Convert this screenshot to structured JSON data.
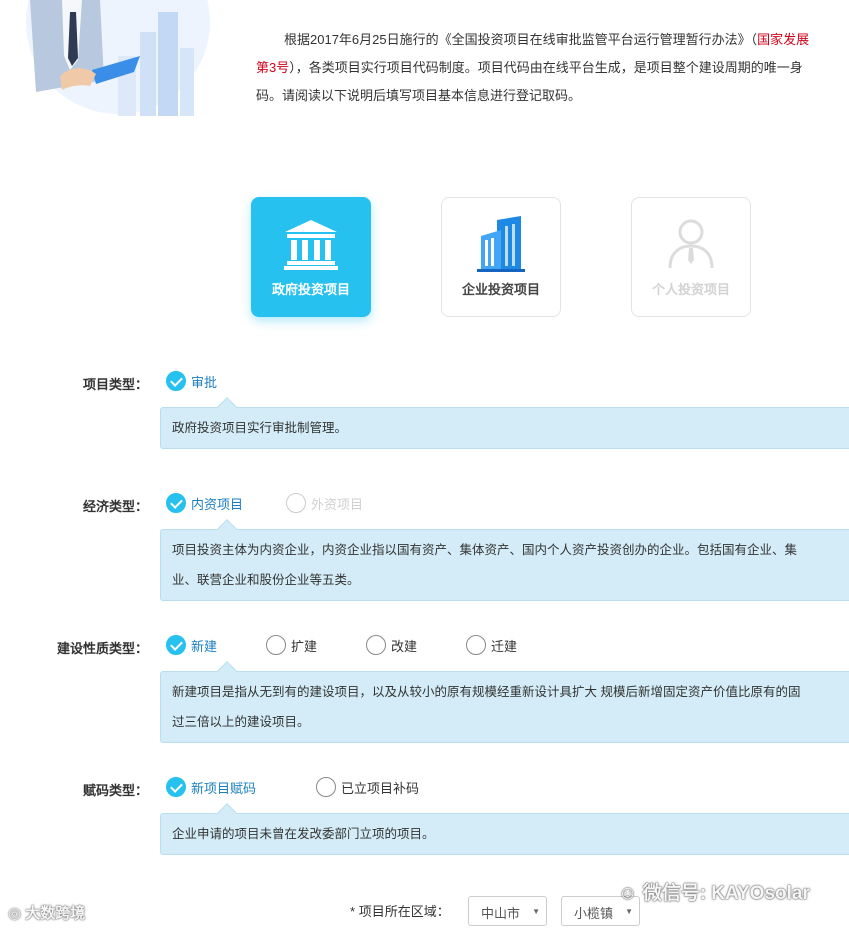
{
  "intro": {
    "line1": "根据2017年6月25日施行的《全国投资项目在线审批监管平台运行管理暂行办法》（",
    "line1_red": "国家发展",
    "line2_red": "第3号",
    "line2": "），各类项目实行项目代码制度。项目代码由在线平台生成，是项目整个建设周期的唯一身",
    "line3": "码。请阅读以下说明后填写项目基本信息进行登记取码。"
  },
  "categories": [
    {
      "label": "政府投资项目",
      "icon": "government-building-icon",
      "state": "active"
    },
    {
      "label": "企业投资项目",
      "icon": "office-building-icon",
      "state": "normal"
    },
    {
      "label": "个人投资项目",
      "icon": "person-icon",
      "state": "disabled"
    }
  ],
  "form": {
    "project_type": {
      "label": "项目类型：",
      "options": [
        {
          "label": "审批",
          "checked": true
        }
      ],
      "description": "政府投资项目实行审批制管理。"
    },
    "economic_type": {
      "label": "经济类型：",
      "options": [
        {
          "label": "内资项目",
          "checked": true
        },
        {
          "label": "外资项目",
          "checked": false,
          "disabled": true
        }
      ],
      "description_line1": "项目投资主体为内资企业，内资企业指以国有资产、集体资产、国内个人资产投资创办的企业。包括国有企业、集",
      "description_line2": "业、联营企业和股份企业等五类。"
    },
    "construction_type": {
      "label": "建设性质类型：",
      "options": [
        {
          "label": "新建",
          "checked": true
        },
        {
          "label": "扩建",
          "checked": false
        },
        {
          "label": "改建",
          "checked": false
        },
        {
          "label": "迁建",
          "checked": false
        }
      ],
      "description_line1": "新建项目是指从无到有的建设项目，以及从较小的原有规模经重新设计具扩大 规模后新增固定资产价值比原有的固",
      "description_line2": "过三倍以上的建设项目。"
    },
    "code_type": {
      "label": "赋码类型：",
      "options": [
        {
          "label": "新项目赋码",
          "checked": true
        },
        {
          "label": "已立项目补码",
          "checked": false
        }
      ],
      "description": "企业申请的项目未曾在发改委部门立项的项目。"
    },
    "region": {
      "star": "*",
      "label": "项目所在区域：",
      "city": "中山市",
      "town": "小榄镇"
    }
  },
  "watermarks": {
    "left": "大数跨境",
    "right": "微信号: KAYOsolar"
  },
  "colors": {
    "accent": "#26c1ee",
    "link": "#1a7fc1",
    "red": "#d0021b",
    "panel": "#d3ecf7"
  }
}
